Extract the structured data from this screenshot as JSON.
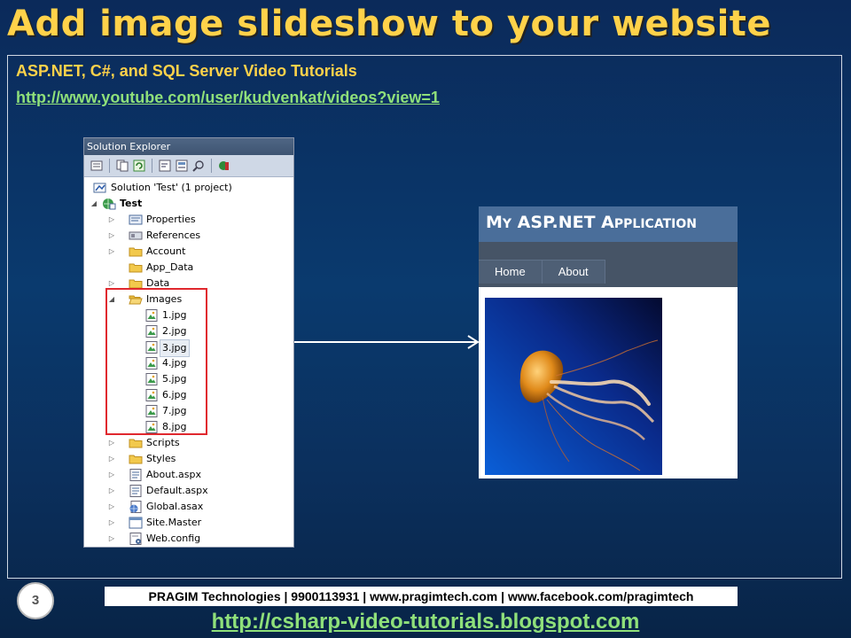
{
  "slide": {
    "title": "Add image slideshow to your website",
    "subtitle": "ASP.NET, C#, and SQL Server Video Tutorials",
    "youtube_link": "http://www.youtube.com/user/kudvenkat/videos?view=1",
    "page_number": "3",
    "footer": "PRAGIM Technologies | 9900113931 | www.pragimtech.com | www.facebook.com/pragimtech",
    "blog_link": "http://csharp-video-tutorials.blogspot.com"
  },
  "solution_explorer": {
    "header": "Solution Explorer",
    "items": [
      {
        "label": "Solution 'Test' (1 project)",
        "icon": "solution-icon",
        "depth": 0,
        "arrow": ""
      },
      {
        "label": "Test",
        "icon": "web-project-icon",
        "depth": 1,
        "arrow": "down",
        "bold": true
      },
      {
        "label": "Properties",
        "icon": "properties-icon",
        "depth": 2,
        "arrow": "right"
      },
      {
        "label": "References",
        "icon": "references-icon",
        "depth": 2,
        "arrow": "right"
      },
      {
        "label": "Account",
        "icon": "folder-icon",
        "depth": 2,
        "arrow": "right"
      },
      {
        "label": "App_Data",
        "icon": "folder-icon",
        "depth": 2,
        "arrow": ""
      },
      {
        "label": "Data",
        "icon": "folder-icon",
        "depth": 2,
        "arrow": "right"
      },
      {
        "label": "Images",
        "icon": "open-folder-icon",
        "depth": 2,
        "arrow": "down"
      },
      {
        "label": "1.jpg",
        "icon": "image-file-icon",
        "depth": 3,
        "arrow": ""
      },
      {
        "label": "2.jpg",
        "icon": "image-file-icon",
        "depth": 3,
        "arrow": ""
      },
      {
        "label": "3.jpg",
        "icon": "image-file-icon",
        "depth": 3,
        "arrow": "",
        "selected": true
      },
      {
        "label": "4.jpg",
        "icon": "image-file-icon",
        "depth": 3,
        "arrow": ""
      },
      {
        "label": "5.jpg",
        "icon": "image-file-icon",
        "depth": 3,
        "arrow": ""
      },
      {
        "label": "6.jpg",
        "icon": "image-file-icon",
        "depth": 3,
        "arrow": ""
      },
      {
        "label": "7.jpg",
        "icon": "image-file-icon",
        "depth": 3,
        "arrow": ""
      },
      {
        "label": "8.jpg",
        "icon": "image-file-icon",
        "depth": 3,
        "arrow": ""
      },
      {
        "label": "Scripts",
        "icon": "folder-icon",
        "depth": 2,
        "arrow": "right"
      },
      {
        "label": "Styles",
        "icon": "folder-icon",
        "depth": 2,
        "arrow": "right"
      },
      {
        "label": "About.aspx",
        "icon": "aspx-file-icon",
        "depth": 2,
        "arrow": "right"
      },
      {
        "label": "Default.aspx",
        "icon": "aspx-file-icon",
        "depth": 2,
        "arrow": "right"
      },
      {
        "label": "Global.asax",
        "icon": "global-asax-icon",
        "depth": 2,
        "arrow": "right"
      },
      {
        "label": "Site.Master",
        "icon": "master-page-icon",
        "depth": 2,
        "arrow": "right"
      },
      {
        "label": "Web.config",
        "icon": "config-file-icon",
        "depth": 2,
        "arrow": "right"
      }
    ]
  },
  "asp_page": {
    "title_big_1": "M",
    "title_small_1": "Y",
    "title_big_2": " ASP.NET A",
    "title_small_2": "PPLICATION",
    "menu": [
      "Home",
      "About"
    ],
    "image": "jellyfish-image"
  },
  "colors": {
    "title": "#ffd24a",
    "link": "#8fe07a",
    "highlight": "#e0282e",
    "asp_header": "#4a6e9a"
  }
}
